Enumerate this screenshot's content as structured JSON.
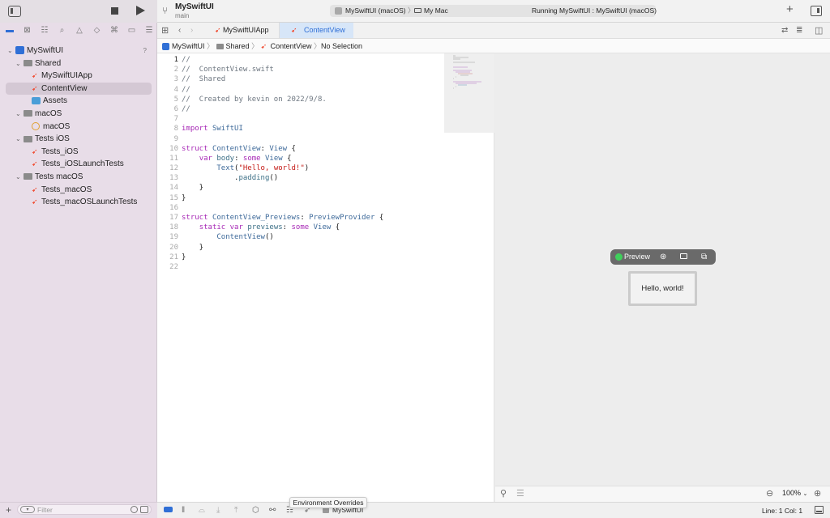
{
  "toolbar": {
    "project_name": "MySwiftUI",
    "branch": "main",
    "scheme": "MySwiftUI (macOS)",
    "destination": "My Mac",
    "status": "Running MySwiftUI : MySwiftUI (macOS)",
    "add_icon": "+"
  },
  "sidebar": {
    "help_badge": "?",
    "filter_placeholder": "Filter",
    "tree": [
      {
        "label": "MySwiftUI",
        "kind": "project"
      },
      {
        "label": "Shared",
        "kind": "folder"
      },
      {
        "label": "MySwiftUIApp",
        "kind": "swift"
      },
      {
        "label": "ContentView",
        "kind": "swift",
        "selected": true
      },
      {
        "label": "Assets",
        "kind": "assets"
      },
      {
        "label": "macOS",
        "kind": "folder"
      },
      {
        "label": "macOS",
        "kind": "entitlements"
      },
      {
        "label": "Tests iOS",
        "kind": "folder"
      },
      {
        "label": "Tests_iOS",
        "kind": "swift"
      },
      {
        "label": "Tests_iOSLaunchTests",
        "kind": "swift"
      },
      {
        "label": "Tests macOS",
        "kind": "folder"
      },
      {
        "label": "Tests_macOS",
        "kind": "swift"
      },
      {
        "label": "Tests_macOSLaunchTests",
        "kind": "swift"
      }
    ]
  },
  "tabs": [
    {
      "label": "MySwiftUIApp",
      "active": false
    },
    {
      "label": "ContentView",
      "active": true
    }
  ],
  "jumpbar": {
    "project": "MySwiftUI",
    "group": "Shared",
    "file": "ContentView",
    "selection": "No Selection"
  },
  "code": [
    "//",
    "//  ContentView.swift",
    "//  Shared",
    "//",
    "//  Created by kevin on 2022/9/8.",
    "//",
    "",
    "import SwiftUI",
    "",
    "struct ContentView: View {",
    "    var body: some View {",
    "        Text(\"Hello, world!\")",
    "            .padding()",
    "    }",
    "}",
    "",
    "struct ContentView_Previews: PreviewProvider {",
    "    static var previews: some View {",
    "        ContentView()",
    "    }",
    "}",
    ""
  ],
  "preview": {
    "pill_label": "Preview",
    "content_text": "Hello, world!",
    "zoom": "100%",
    "tooltip": "Environment Overrides"
  },
  "status_bar": {
    "scheme_label": "MySwiftUI",
    "line_col": "Line: 1  Col: 1"
  },
  "colors": {
    "accent": "#2f6fd6",
    "swift_orange": "#f05138",
    "preview_live": "#3fcf5b",
    "keyword": "#a729b6",
    "type": "#3e6a9a"
  }
}
